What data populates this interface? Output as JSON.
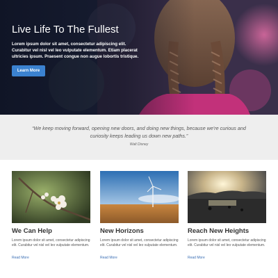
{
  "hero": {
    "title": "Live Life To The Fullest",
    "body": "Lorem ipsum dolor sit amet, consectetur adipiscing elit. Curabitur vel nisl vel leo vulputate elementum. Etiam placerat ultricies ipsum. Praesent congue non augue lobortis tristique.",
    "button_label": "Learn More"
  },
  "quote": {
    "text": "“We keep moving forward, opening new doors, and doing new things, because we're curious and curiosity keeps leading us down new paths.”",
    "author": "Walt Disney"
  },
  "cards": [
    {
      "title": "We Can Help",
      "body": "Lorem ipsum dolor sit amet, consectetur adipiscing elit. Curabitur vel nisl vel leo vulputate elementum.",
      "link": "Read More"
    },
    {
      "title": "New Horizons",
      "body": "Lorem ipsum dolor sit amet, consectetur adipiscing elit. Curabitur vel nisl vel leo vulputate elementum.",
      "link": "Read More"
    },
    {
      "title": "Reach New Heights",
      "body": "Lorem ipsum dolor sit amet, consectetur adipiscing elit. Curabitur vel nisl vel leo vulputate elementum.",
      "link": "Read More"
    }
  ],
  "colors": {
    "accent": "#3b82d0",
    "link": "#3b6fb5",
    "quote_band": "#eeeeee"
  }
}
